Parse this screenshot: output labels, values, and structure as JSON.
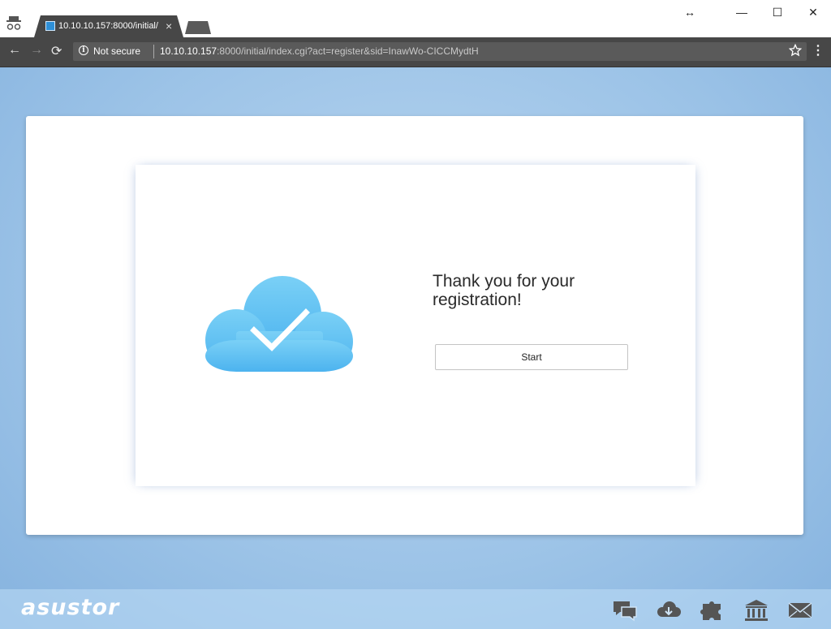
{
  "browser": {
    "tab_title": "10.10.10.157:8000/initial/",
    "tab_close": "×",
    "security_label": "Not secure",
    "url_host": "10.10.10.157",
    "url_path": ":8000/initial/index.cgi?act=register&sid=InawWo-CICCMydtH",
    "bookmark_icon": "star-icon",
    "menu_icon": "⋮",
    "nav": {
      "back": "←",
      "forward": "→",
      "reload": "⟳"
    },
    "window": {
      "resize": "↔",
      "minimize": "—",
      "maximize": "☐",
      "close": "✕"
    }
  },
  "main": {
    "message": "Thank you for your registration!",
    "start_label": "Start",
    "icon": "cloud-check-icon"
  },
  "footer": {
    "logo": "asustor",
    "icons": [
      "chat-icon",
      "cloud-download-icon",
      "apps-icon",
      "bank-icon",
      "mail-icon"
    ]
  },
  "colors": {
    "cloud": "#5bbcf2",
    "background": "#9cc4e6"
  }
}
